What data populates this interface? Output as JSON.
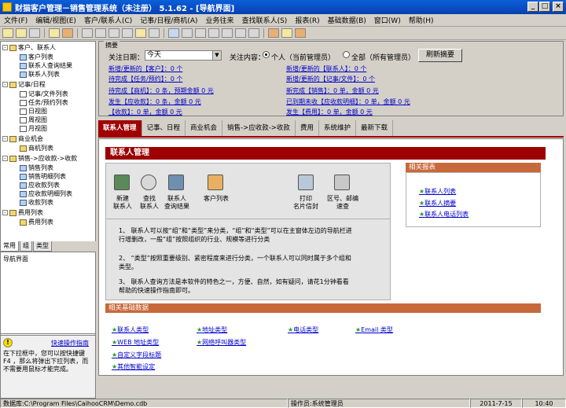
{
  "window": {
    "title": "财猫客户管理－销售管理系统（未注册）  5.1.62 - [导航界面]"
  },
  "menu": [
    "文件(F)",
    "编辑/视图(E)",
    "客户/联系人(C)",
    "记事/日程/商机(A)",
    "业务往来",
    "查找联系人(S)",
    "报表(R)",
    "基础数据(B)",
    "窗口(W)",
    "帮助(H)"
  ],
  "tree": {
    "group1": "客户、联系人",
    "g1_items": [
      "客户列表",
      "联系人查询结果",
      "联系人列表"
    ],
    "group2": "记事/日程",
    "g2_items": [
      "记事/文件列表",
      "任务/预约列表",
      "日视图",
      "周视图",
      "月视图"
    ],
    "group3": "商业机会",
    "g3_items": [
      "商机列表"
    ],
    "group4": "销售->应收款->收款",
    "g4_items": [
      "销售列表",
      "销售明细列表",
      "应收款列表",
      "应收款明细列表",
      "收款列表"
    ],
    "group5": "费用列表",
    "g5_items": [
      "费用列表"
    ]
  },
  "left_tabs": [
    "常用",
    "组",
    "类型"
  ],
  "nav_label": "导航界面",
  "quick": {
    "title": "快速操作指南",
    "text": "在下拉框中，您可以按快捷键 F4 ，那么将弹出下拉列表，而不需要用鼠标才能完成。"
  },
  "summary": {
    "group_title": "摘要",
    "date_label": "关注日期：",
    "date_value": "今天",
    "content_label": "关注内容：",
    "opt_personal": "个人（当前管理员）",
    "opt_all": "全部（所有管理员）",
    "refresh": "刷新摘要",
    "links_left": [
      "新增/更新的【客户】：0 个",
      "待完成【任务/预约】：0 个",
      "待完成【商机】：0 条，预期金额 0 元",
      "发生【应收款】：0 条，金额 0 元",
      "【收款】：0 单，金额 0 元"
    ],
    "links_right": [
      "新增/更新的【联系人】：0 个",
      "新增/更新的【记事/文件】：0 个",
      "新完成【销售】：0 单，金额 0 元",
      "已到期未收【应收款明细】：0 单，金额 0 元",
      "发生【费用】：0 单，金额 0 元"
    ]
  },
  "main_tabs": [
    "联系人管理",
    "记事、日程",
    "商业机会",
    "销售->应收款->收款",
    "费用",
    "系统维护",
    "最新下载"
  ],
  "panel": {
    "title": "联系人管理",
    "icons": [
      "新建\n联系人",
      "查找\n联系人",
      "联系人\n查询结果",
      "客户列表",
      "打印\n名片信封",
      "区号、邮编\n速查"
    ],
    "paras": [
      "1、 联系人可以按“组”和“类型”来分类，“组”和“类型”可以在主窗体左边的导航栏进行增删改，一般“组”按照组织的行业、规模等进行分类",
      "2、 “类型”按照重要级别、紧密程度来进行分类，一个联系人可以同时属于多个组和类型。",
      "3、 联系人查询方法是本软件的特色之一，方便、自然，如有疑问，请花1分钟看看帮助的快速操作指南即可。"
    ],
    "related_reports_title": "相关报表",
    "related_reports": [
      "联系人列表",
      "联系人摘要",
      "联系人电话列表"
    ],
    "basic_title": "相关基础数据",
    "basic": [
      "联系人类型",
      "地址类型",
      "电话类型",
      "Email 类型",
      "WEB 地址类型",
      "网络呼叫器类型",
      "自定义字段标题",
      "其他智能设定"
    ]
  },
  "status": {
    "db": "数据库:C:\\Program Files\\CaihooCRM\\Demo.cdb",
    "op": "操作员:系统管理员",
    "date": "2011-7-15",
    "time": "10:40"
  }
}
